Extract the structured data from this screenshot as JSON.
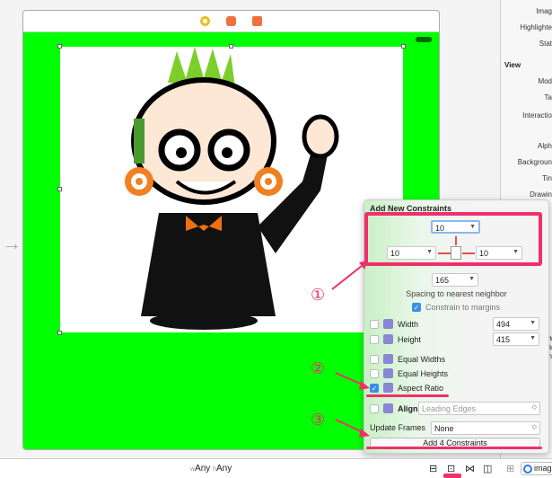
{
  "scene": {
    "bar_icons": [
      "view-controller-icon",
      "first-responder-icon",
      "exit-icon"
    ]
  },
  "inspector": {
    "labels": [
      "Imag",
      "Highlighte",
      "Stat"
    ],
    "section": "View",
    "view_labels": [
      "Mod",
      "Ta",
      "Interactio",
      "Alph",
      "Backgroun",
      "Tin",
      "Drawin"
    ],
    "right_edge": [
      "n",
      "na",
      "n"
    ]
  },
  "popover": {
    "title": "Add New Constraints",
    "top": "10",
    "left": "10",
    "right": "10",
    "bottom": "165",
    "spacing_label": "Spacing to nearest neighbor",
    "constrain_margins": {
      "label": "Constrain to margins",
      "checked": true
    },
    "width": {
      "label": "Width",
      "value": "494",
      "checked": false
    },
    "height": {
      "label": "Height",
      "value": "415",
      "checked": false
    },
    "equal_widths": {
      "label": "Equal Widths",
      "checked": false
    },
    "equal_heights": {
      "label": "Equal Heights",
      "checked": false
    },
    "aspect_ratio": {
      "label": "Aspect Ratio",
      "checked": true
    },
    "align": {
      "label": "Align",
      "value": "Leading Edges",
      "checked": false
    },
    "update_frames": {
      "label": "Update Frames",
      "value": "None"
    },
    "add_button": "Add 4 Constraints"
  },
  "annotations": [
    "①",
    "②",
    "③"
  ],
  "toolbar": {
    "w_prefix": "w",
    "w": "Any",
    "h_prefix": "h",
    "h": "Any",
    "image_label": "imag"
  },
  "colors": {
    "accent": "#f0306a",
    "canvas_bg": "#00ff00"
  }
}
